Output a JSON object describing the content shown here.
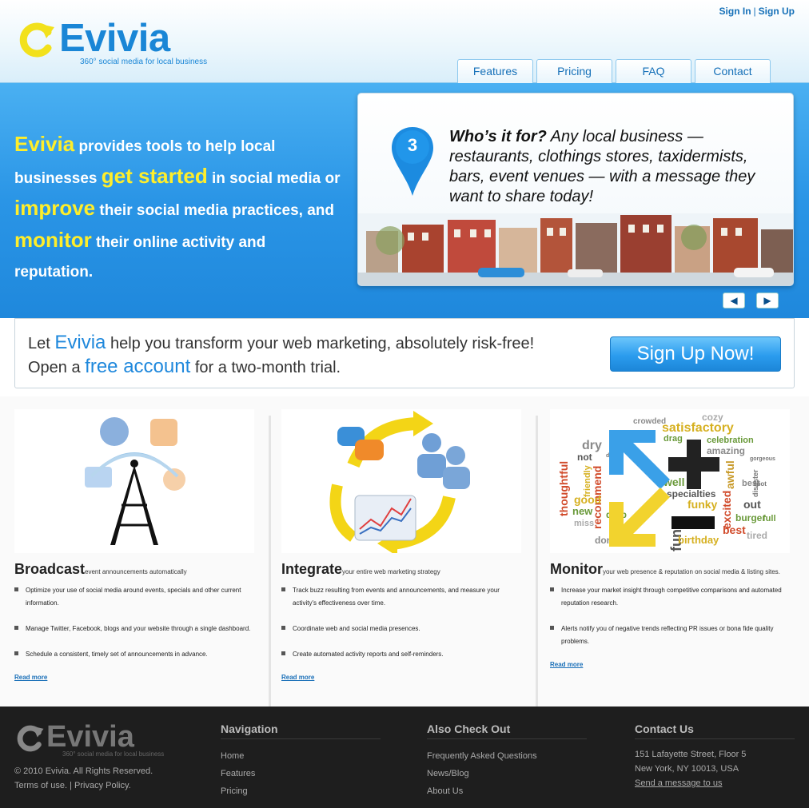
{
  "header": {
    "logo_text": "Evivia",
    "tagline": "360° social media for local business",
    "sign_in": "Sign In",
    "auth_separator": "|",
    "sign_up": "Sign Up",
    "nav": [
      "Features",
      "Pricing",
      "FAQ",
      "Contact"
    ]
  },
  "hero": {
    "p1": "Evivia",
    "p2": " provides tools to help local businesses ",
    "p3": "get started",
    "p4": " in social media or ",
    "p5": "improve",
    "p6": " their social media practices, and ",
    "p7": "monitor",
    "p8": " their online activity and reputation.",
    "slide": {
      "number": "3",
      "question": "Who’s it for?",
      "answer": " Any local business — restaurants, clothings stores, taxidermists, bars, event venues — with a message they want to share today!"
    },
    "prev_icon": "◀",
    "next_icon": "▶"
  },
  "cta": {
    "l1a": "Let ",
    "l1b": "Evivia",
    "l1c": " help you transform your web marketing, absolutely risk-free!",
    "l2a": "Open a ",
    "l2b": "free account",
    "l2c": " for a two-month trial.",
    "button": "Sign Up Now!"
  },
  "features": [
    {
      "title": "Broadcast",
      "subtitle": "event announcements automatically",
      "items": [
        "Optimize your use of social media around events, specials and other current information.",
        "Manage Twitter, Facebook, blogs and your website through a single dashboard.",
        "Schedule a consistent, timely set of announcements in advance."
      ],
      "read_more": "Read more"
    },
    {
      "title": "Integrate",
      "subtitle": "your entire web marketing strategy",
      "items": [
        "Track buzz resulting from events and announcements, and measure your activity's effectiveness over time.",
        "Coordinate web and social media presences.",
        "Create automated activity reports and self-reminders."
      ],
      "read_more": "Read more"
    },
    {
      "title": "Monitor",
      "subtitle": "your web presence & reputation on social media & listing sites.",
      "items": [
        "Increase your market insight through competitive comparisons and automated reputation research.",
        "Alerts notify you of negative trends reflecting PR issues or bona fide quality problems."
      ],
      "read_more": "Read more"
    }
  ],
  "wordcloud": [
    "satisfactory",
    "celebration",
    "amazing",
    "crowded",
    "cozy",
    "dry",
    "not",
    "best",
    "drag",
    "well",
    "specialties",
    "funky",
    "excited",
    "awful",
    "recommend",
    "fun",
    "best",
    "birthday",
    "done",
    "new",
    "miss",
    "good",
    "drab",
    "out",
    "burger",
    "full",
    "tired",
    "gorgeous",
    "disaster",
    "spot",
    "dead",
    "thoughtful",
    "friendly"
  ],
  "footer": {
    "logo_text": "Evivia",
    "tagline": "360° social media for local business",
    "copyright": "© 2010 Evivia. All Rights Reserved.",
    "terms": "Terms of use.",
    "sep": "|",
    "privacy": "Privacy Policy.",
    "nav_title": "Navigation",
    "nav_links": [
      "Home",
      "Features",
      "Pricing"
    ],
    "also_title": "Also Check Out",
    "also_links": [
      "Frequently Asked Questions",
      "News/Blog",
      "About Us"
    ],
    "contact_title": "Contact Us",
    "address1": "151 Lafayette Street, Floor 5",
    "address2": "New York, NY 10013, USA",
    "send": "Send a message to us"
  }
}
